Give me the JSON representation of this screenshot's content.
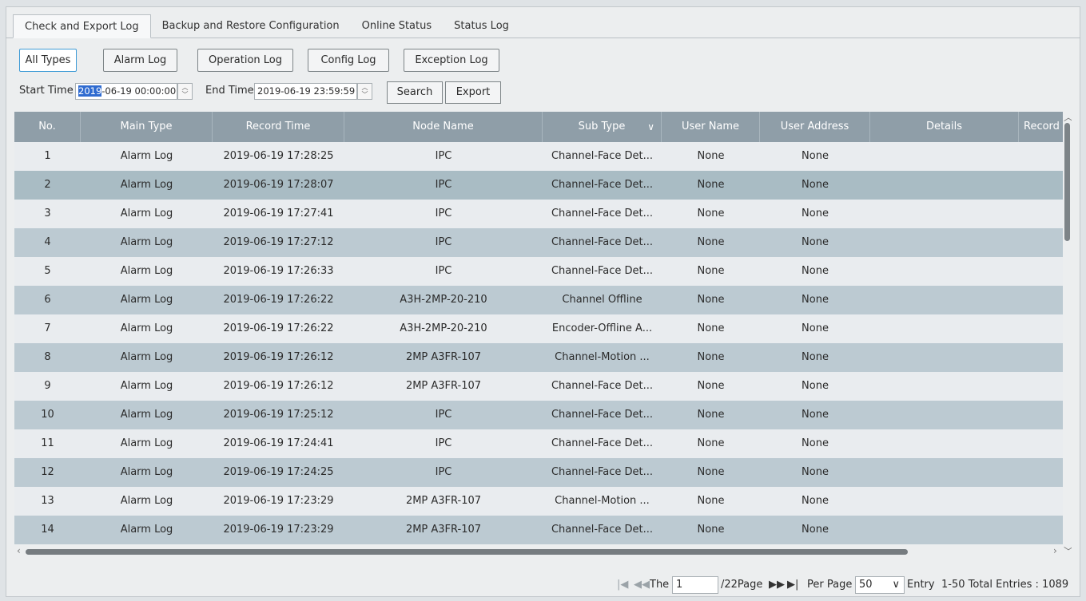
{
  "tabs": [
    "Check and Export Log",
    "Backup and Restore Configuration",
    "Online Status",
    "Status Log"
  ],
  "type_buttons": [
    "All Types",
    "Alarm Log",
    "Operation Log",
    "Config Log",
    "Exception Log"
  ],
  "filter": {
    "start_label": "Start Time",
    "start_sel": "2019",
    "start_rest": "-06-19 00:00:00",
    "end_label": "End Time",
    "end_value": "2019-06-19 23:59:59",
    "search": "Search",
    "export": "Export"
  },
  "columns": [
    "No.",
    "Main Type",
    "Record Time",
    "Node Name",
    "Sub Type",
    "User Name",
    "User Address",
    "Details",
    "Record P"
  ],
  "rows": [
    [
      "1",
      "Alarm Log",
      "2019-06-19 17:28:25",
      "IPC",
      "Channel-Face Det...",
      "None",
      "None"
    ],
    [
      "2",
      "Alarm Log",
      "2019-06-19 17:28:07",
      "IPC",
      "Channel-Face Det...",
      "None",
      "None"
    ],
    [
      "3",
      "Alarm Log",
      "2019-06-19 17:27:41",
      "IPC",
      "Channel-Face Det...",
      "None",
      "None"
    ],
    [
      "4",
      "Alarm Log",
      "2019-06-19 17:27:12",
      "IPC",
      "Channel-Face Det...",
      "None",
      "None"
    ],
    [
      "5",
      "Alarm Log",
      "2019-06-19 17:26:33",
      "IPC",
      "Channel-Face Det...",
      "None",
      "None"
    ],
    [
      "6",
      "Alarm Log",
      "2019-06-19 17:26:22",
      "A3H-2MP-20-210",
      "Channel Offline",
      "None",
      "None"
    ],
    [
      "7",
      "Alarm Log",
      "2019-06-19 17:26:22",
      "A3H-2MP-20-210",
      "Encoder-Offline A...",
      "None",
      "None"
    ],
    [
      "8",
      "Alarm Log",
      "2019-06-19 17:26:12",
      "2MP A3FR-107",
      "Channel-Motion ...",
      "None",
      "None"
    ],
    [
      "9",
      "Alarm Log",
      "2019-06-19 17:26:12",
      "2MP A3FR-107",
      "Channel-Face Det...",
      "None",
      "None"
    ],
    [
      "10",
      "Alarm Log",
      "2019-06-19 17:25:12",
      "IPC",
      "Channel-Face Det...",
      "None",
      "None"
    ],
    [
      "11",
      "Alarm Log",
      "2019-06-19 17:24:41",
      "IPC",
      "Channel-Face Det...",
      "None",
      "None"
    ],
    [
      "12",
      "Alarm Log",
      "2019-06-19 17:24:25",
      "IPC",
      "Channel-Face Det...",
      "None",
      "None"
    ],
    [
      "13",
      "Alarm Log",
      "2019-06-19 17:23:29",
      "2MP A3FR-107",
      "Channel-Motion ...",
      "None",
      "None"
    ],
    [
      "14",
      "Alarm Log",
      "2019-06-19 17:23:29",
      "2MP A3FR-107",
      "Channel-Face Det...",
      "None",
      "None"
    ]
  ],
  "pager": {
    "the": "The",
    "page_value": "1",
    "page_total": "/22Page",
    "per_page": "Per Page",
    "per_page_value": "50",
    "entry": "Entry",
    "summary": "1-50 Total Entries : 1089"
  },
  "colors": {
    "header": "#8f9ea8",
    "row_alt": "#bccad2",
    "selected": "#a9bcc4",
    "accent": "#3e9bd6"
  },
  "icons": [
    "spin-icon",
    "chevron-down-icon",
    "first-page-icon",
    "prev-page-icon",
    "next-page-icon",
    "last-page-icon",
    "scroll-arrow-icon"
  ]
}
